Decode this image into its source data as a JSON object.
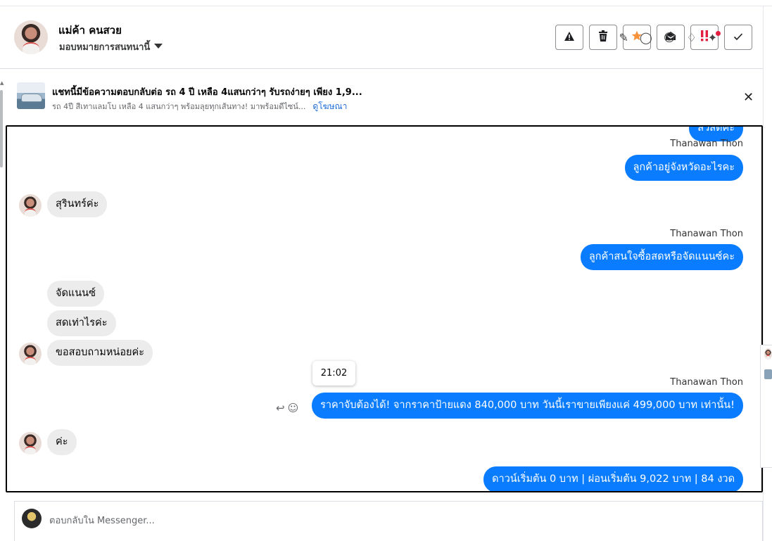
{
  "header": {
    "name": "แม่ค้า คนสวย",
    "assign_label": "มอบหมายการสนทนานี้",
    "actions": [
      {
        "icon": "warning-icon",
        "glyph": "⚠"
      },
      {
        "icon": "trash-icon",
        "glyph": "🗑"
      },
      {
        "icon": "star-icon",
        "glyph": "★",
        "color": "#f7923b"
      },
      {
        "icon": "envelope-open-icon",
        "glyph": "✉"
      },
      {
        "icon": "priority-icon",
        "glyph": "‼",
        "color": "#e41e3f"
      },
      {
        "icon": "check-icon",
        "glyph": "✓"
      }
    ]
  },
  "ad": {
    "title": "แชทนี้มีข้อความตอบกลับต่อ รถ 4 ปี เหลือ 4แสนกว่าๆ รับรถง่ายๆ เพียง 1,9...",
    "subtitle": "รถ 4ปี สีเทาแลมโบ เหลือ 4 แสนกว่าๆ พร้อมลุยทุกเส้นทาง! มาพร้อมดีไซน์...",
    "link": "ดูโฆษณา",
    "close": "✕"
  },
  "messages": {
    "partial_top": "สวัสดีค่ะ",
    "m1_sender": "Thanawan Thon",
    "m1": "ลูกค้าอยู่จังหวัดอะไรคะ",
    "m2": "สุรินทร์ค่ะ",
    "m3_sender": "Thanawan Thon",
    "m3": "ลูกค้าสนใจซื้อสดหรือจัดแนนซ์คะ",
    "m4": "จัดแนนซ์",
    "m5": "สดเท่าไรค่ะ",
    "m6": "ขอสอบถามหน่อยค่ะ",
    "tooltip_time": "21:02",
    "m7_sender": "Thanawan Thon",
    "m7": "ราคาจับต้องได้! จากราคาป้ายแดง 840,000 บาท วันนี้เราขายเพียงแค่ 499,000 บาท เท่านั้น!",
    "m8": "ค่ะ",
    "m9": "ดาวน์เริ่มต้น 0 บาท | ผ่อนเริ่มต้น 9,022 บาท | 84 งวด"
  },
  "composer": {
    "placeholder": "ตอบกลับใน Messenger..."
  },
  "colors": {
    "outgoing_bubble": "#0a7cff",
    "incoming_bubble": "#ececec",
    "link": "#216fdb"
  }
}
